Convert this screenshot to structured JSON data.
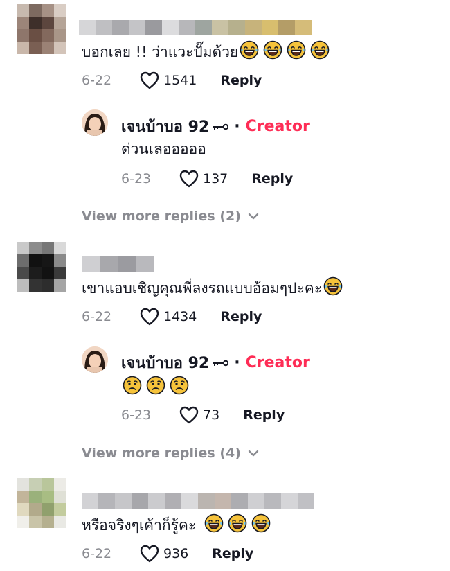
{
  "comments": [
    {
      "text": "บอกเลย !! ว่าแวะปั๊มด้วย",
      "emoji_count": 4,
      "emoji": "laugh-tears",
      "date": "6-22",
      "likes": "1541",
      "reply_label": "Reply",
      "reply": {
        "author": "เจนบ้าบอ 92",
        "author_suffix_icon": "key-icon",
        "badge": "Creator",
        "text": "ด่วนเลอออออ",
        "date": "6-23",
        "likes": "137",
        "reply_label": "Reply"
      },
      "view_more": "View more replies (2)"
    },
    {
      "text": "เขาแอบเชิญคุณพี่ลงรถแบบอ้อมๆปะคะ",
      "emoji_count": 1,
      "emoji": "laugh-tears",
      "date": "6-22",
      "likes": "1434",
      "reply_label": "Reply",
      "reply": {
        "author": "เจนบ้าบอ 92",
        "author_suffix_icon": "key-icon",
        "badge": "Creator",
        "text": "",
        "reply_emoji": "sad-face",
        "reply_emoji_count": 3,
        "date": "6-23",
        "likes": "73",
        "reply_label": "Reply"
      },
      "view_more": "View more replies (4)"
    },
    {
      "text": "หรือจริงๆเค้าก็รู้คะ",
      "emoji_count": 3,
      "emoji": "laugh-tears",
      "date": "6-22",
      "likes": "936",
      "reply_label": "Reply"
    }
  ],
  "colors": {
    "accent": "#fe2c55",
    "muted": "#8a8b91",
    "text": "#161823",
    "emoji_yellow": "#f6c33b"
  }
}
